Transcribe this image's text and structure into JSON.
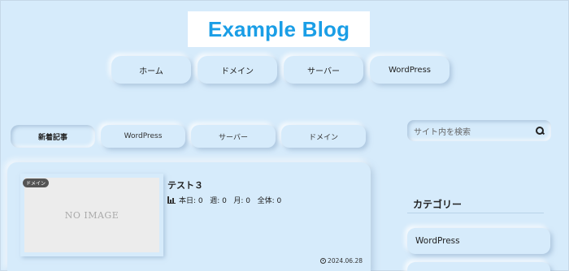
{
  "header": {
    "site_title": "Example Blog"
  },
  "nav": {
    "items": [
      {
        "label": "ホーム"
      },
      {
        "label": "ドメイン"
      },
      {
        "label": "サーバー"
      },
      {
        "label": "WordPress"
      }
    ]
  },
  "tabs": {
    "items": [
      {
        "label": "新着記事",
        "active": true
      },
      {
        "label": "WordPress"
      },
      {
        "label": "サーバー"
      },
      {
        "label": "ドメイン"
      }
    ]
  },
  "post": {
    "category": "ドメイン",
    "thumbnail_text": "NO IMAGE",
    "title": "テスト３",
    "stats": "本日: 0   週: 0   月: 0   全体: 0",
    "date": "2024.06.28"
  },
  "sidebar": {
    "search_placeholder": "サイト内を検索",
    "category_heading": "カテゴリー",
    "categories": [
      {
        "label": "WordPress"
      }
    ]
  },
  "colors": {
    "background": "#d6ebfb",
    "brand": "#1a9ee6"
  },
  "icons": {
    "stats": "bar-chart-icon",
    "date": "clock-icon",
    "search": "search-icon"
  }
}
